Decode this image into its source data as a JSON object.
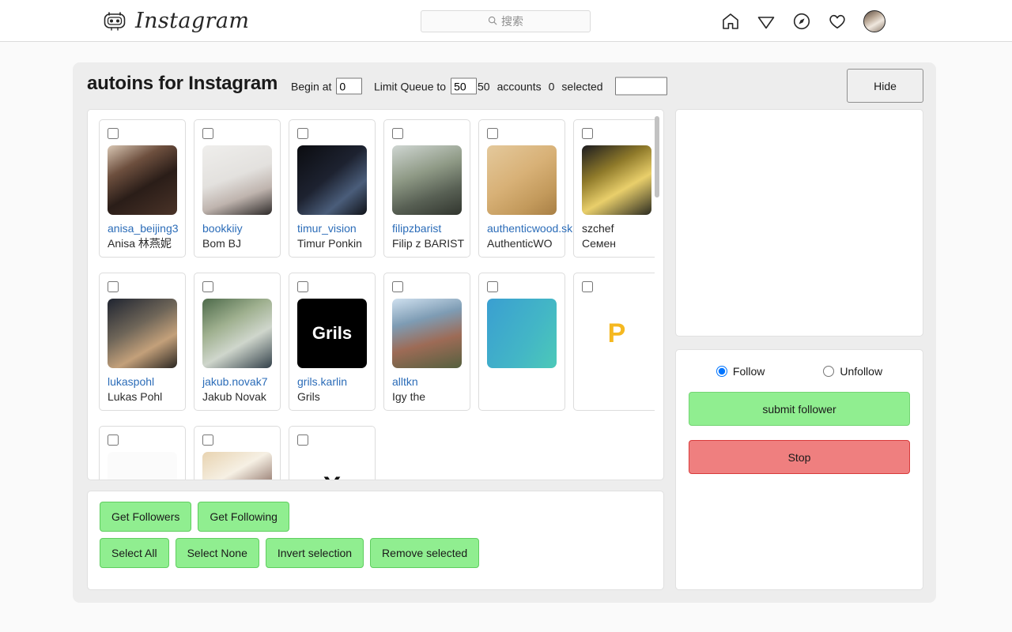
{
  "topnav": {
    "brand_name": "Instagram",
    "brand_icon": "robot-icon",
    "search": {
      "icon": "search-icon",
      "placeholder": "搜索",
      "value": ""
    },
    "icons": [
      {
        "name": "home-icon"
      },
      {
        "name": "paper-plane-icon"
      },
      {
        "name": "compass-explore-icon"
      },
      {
        "name": "heart-activity-icon"
      },
      {
        "name": "profile-avatar"
      }
    ]
  },
  "app": {
    "title": "autoins for Instagram",
    "begin_at_label": "Begin at",
    "begin_at_value": "0",
    "limit_queue_label": "Limit Queue to",
    "limit_queue_value": "50",
    "accounts_count": "50",
    "accounts_label": "accounts",
    "selected_count": "0",
    "selected_label": "selected",
    "filter_value": "",
    "hide_label": "Hide"
  },
  "accounts": [
    {
      "username": "anisa_beijing3",
      "fullname": "Anisa 林燕妮",
      "checked": false,
      "link": true,
      "avatar": "linear-gradient(150deg,#d9c7b4 0%,#6d4f3e 30%,#2a1d18 58%,#4a3328 100%)"
    },
    {
      "username": "bookkiiy",
      "fullname": "Bom BJ",
      "checked": false,
      "link": true,
      "avatar": "linear-gradient(160deg,#efeeec 0%,#e3e1de 45%,#bfb4ae 70%,#2e2a29 100%)"
    },
    {
      "username": "timur_vision",
      "fullname": "Timur Ponkin",
      "checked": false,
      "link": true,
      "avatar": "linear-gradient(140deg,#0b0c10 0%,#1d2230 45%,#4a5d7a 72%,#101218 100%)"
    },
    {
      "username": "filipzbarist",
      "fullname": "Filip z BARIST",
      "checked": false,
      "link": true,
      "avatar": "linear-gradient(160deg,#cfd6d2 0%,#8f9a86 40%,#586054 70%,#31352e 100%)"
    },
    {
      "username": "authenticwood.sk",
      "fullname": "AuthenticWO",
      "checked": false,
      "link": true,
      "avatar": "linear-gradient(145deg,#e4c99c 0%,#d8b177 45%,#c39a5c 75%,#a87f45 100%)"
    },
    {
      "username": "szchef",
      "fullname": "Семен",
      "checked": false,
      "link": false,
      "avatar": "linear-gradient(150deg,#1b1b1f 0%,#8f7a2a 35%,#e9cf6b 62%,#2b2b20 100%)"
    },
    {
      "username": "lukaspohl",
      "fullname": "Lukas Pohl",
      "checked": false,
      "link": true,
      "avatar": "linear-gradient(150deg,#1f2430 0%,#6e6558 40%,#c3a07a 68%,#2b2722 100%)"
    },
    {
      "username": "jakub.novak7",
      "fullname": "Jakub Novak",
      "checked": false,
      "link": true,
      "avatar": "linear-gradient(150deg,#4d6a4a 0%,#9fb08f 35%,#cfd6cc 62%,#33414a 100%)"
    },
    {
      "username": "grils.karlin",
      "fullname": "Grils",
      "checked": false,
      "link": true,
      "avatar": "#000000",
      "avatar_text": "Grils"
    },
    {
      "username": "alltkn",
      "fullname": "Igy the",
      "checked": false,
      "link": true,
      "avatar": "linear-gradient(165deg,#cfe0ef 0%,#7e9cb4 32%,#9d6b56 62%,#55603f 100%)"
    },
    {
      "username": "",
      "fullname": "",
      "checked": false,
      "link": true,
      "avatar": "linear-gradient(120deg,#3a9fd1 0%,#43b6c6 60%,#4cc9b8 100%)",
      "avatar_text": ""
    },
    {
      "username": "",
      "fullname": "",
      "checked": false,
      "link": true,
      "avatar": "#ffffff",
      "avatar_text": "P"
    },
    {
      "username": "",
      "fullname": "",
      "checked": false,
      "link": true,
      "avatar": "#fbfbfb",
      "avatar_text": ""
    },
    {
      "username": "",
      "fullname": "",
      "checked": false,
      "link": true,
      "avatar": "linear-gradient(150deg,#e8d3b0 0%,#f6f0e4 35%,#7a5a50 75%,#3b2a28 100%)",
      "avatar_text": ""
    },
    {
      "username": "",
      "fullname": "",
      "checked": false,
      "link": true,
      "avatar": "#ffffff",
      "avatar_text": "X"
    }
  ],
  "actions": {
    "get_followers": "Get Followers",
    "get_following": "Get Following",
    "select_all": "Select All",
    "select_none": "Select None",
    "invert_selection": "Invert selection",
    "remove_selected": "Remove selected"
  },
  "controls": {
    "follow_label": "Follow",
    "unfollow_label": "Unfollow",
    "mode": "Follow",
    "submit_label": "submit follower",
    "stop_label": "Stop"
  },
  "log": {
    "text": ""
  },
  "colors": {
    "green_button": "#90ee90",
    "red_button": "#ef7f7f",
    "link_blue": "#2b6cb8",
    "panel_bg": "#ededed",
    "page_bg": "#fafafa"
  }
}
